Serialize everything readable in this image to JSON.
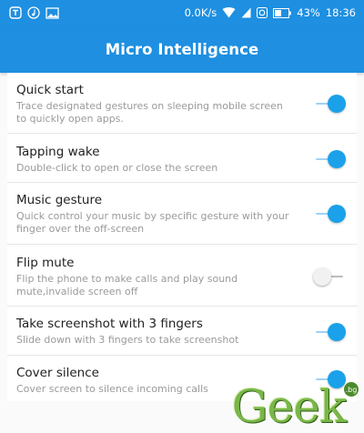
{
  "status_bar": {
    "left_icons": [
      "notification-app-icon",
      "music-note-icon",
      "gallery-icon"
    ],
    "network_speed": "0.0K/s",
    "battery": "43%",
    "time": "18:36"
  },
  "app_bar": {
    "title": "Micro Intelligence"
  },
  "settings": [
    {
      "title": "Quick start",
      "description": "Trace designated gestures on sleeping mobile screen to quickly open apps.",
      "enabled": true
    },
    {
      "title": "Tapping wake",
      "description": "Double-click to open or close the screen",
      "enabled": true
    },
    {
      "title": "Music gesture",
      "description": "Quick control your music by specific gesture with your finger over the off-screen",
      "enabled": true
    },
    {
      "title": "Flip mute",
      "description": "Flip the phone to make calls and play sound mute,invalide screen off",
      "enabled": false
    },
    {
      "title": "Take screenshot with 3 fingers",
      "description": "Slide down with 3 fingers to take screenshot",
      "enabled": true
    },
    {
      "title": "Cover silence",
      "description": "Cover screen to silence incoming calls",
      "enabled": true
    }
  ],
  "watermark": {
    "text": "Geek",
    "tld": ".bg"
  },
  "colors": {
    "accent": "#1e8fe1",
    "toggle_on": "#1aa1ea",
    "toggle_off": "#f1f1f1"
  }
}
